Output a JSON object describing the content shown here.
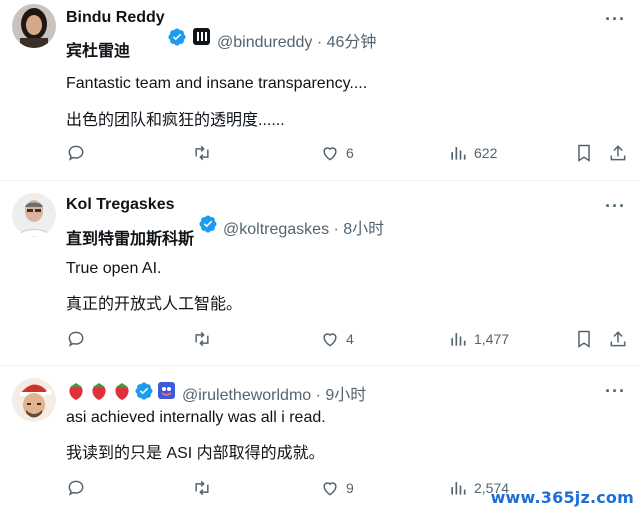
{
  "tweets": [
    {
      "display_name": "Bindu Reddy",
      "display_name_translated": "宾杜雷迪",
      "handle_time": "@bindureddy · 46分钟",
      "text_line1": "Fantastic team and insane transparency....",
      "text_line2": "出色的团队和疯狂的透明度......",
      "replies": "",
      "retweets": "",
      "likes": "6",
      "views": "622"
    },
    {
      "display_name": "Kol Tregaskes",
      "display_name_translated": "直到特雷加斯科斯",
      "handle_time": "@koltregaskes · 8小时",
      "text_line1": "True open AI.",
      "text_line2": "真正的开放式人工智能。",
      "replies": "",
      "retweets": "",
      "likes": "4",
      "views": "1,477"
    },
    {
      "display_name": "",
      "handle_time": "@iruletheworldmo · 9小时",
      "text_line1": "asi achieved internally was all i read.",
      "text_line2": "我读到的只是 ASI 内部取得的成就。",
      "replies": "",
      "retweets": "",
      "likes": "9",
      "views": "2,574"
    }
  ],
  "more_glyph": "···",
  "strawberry_emoji": "🍓",
  "watermark": "www.365jz.com",
  "colors": {
    "text": "#0f1419",
    "secondary": "#536471",
    "verified_blue": "#1d9bf0",
    "divider": "#eff3f4"
  },
  "icons": [
    "reply-icon",
    "retweet-icon",
    "like-icon",
    "views-icon",
    "bookmark-icon",
    "share-icon",
    "verified-badge-icon",
    "more-icon"
  ]
}
